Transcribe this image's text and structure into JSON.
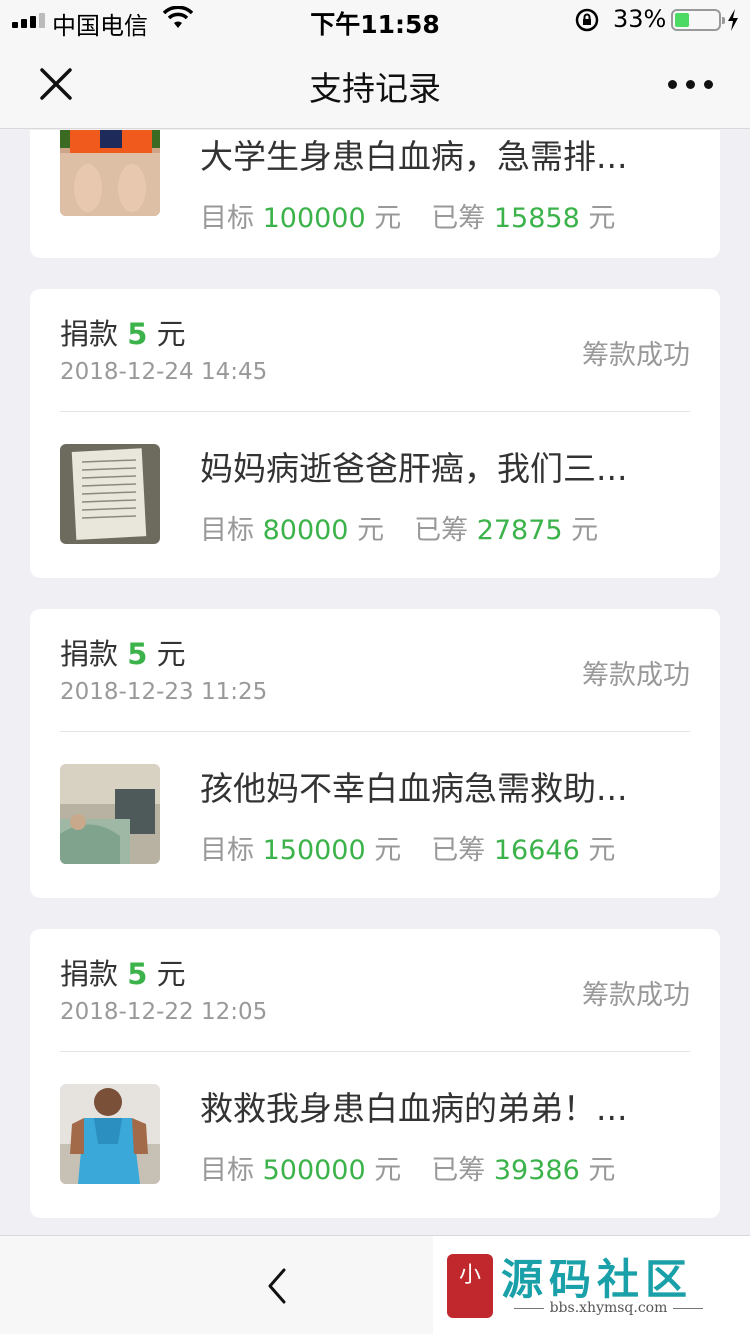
{
  "status_bar": {
    "carrier": "中国电信",
    "time": "下午11:58",
    "battery_pct": "33%",
    "battery_level": 0.33
  },
  "nav": {
    "title": "支持记录"
  },
  "labels": {
    "donate_prefix": "捐款 ",
    "donate_suffix": " 元",
    "status": "筹款成功",
    "target_label": "目标 ",
    "raised_label": "已筹 ",
    "unit": " 元"
  },
  "partial_record": {
    "project": {
      "title": "大学生身患白血病，急需排...",
      "target": "100000",
      "raised": "15858"
    }
  },
  "records": [
    {
      "amount": "5",
      "date": "2018-12-24 14:45",
      "status": "筹款成功",
      "project": {
        "title": "妈妈病逝爸爸肝癌，我们三...",
        "target": "80000",
        "raised": "27875"
      }
    },
    {
      "amount": "5",
      "date": "2018-12-23 11:25",
      "status": "筹款成功",
      "project": {
        "title": "孩他妈不幸白血病急需救助...",
        "target": "150000",
        "raised": "16646"
      }
    },
    {
      "amount": "5",
      "date": "2018-12-22 12:05",
      "status": "筹款成功",
      "project": {
        "title": "救救我身患白血病的弟弟！...",
        "target": "500000",
        "raised": "39386"
      }
    }
  ],
  "watermark": {
    "seal_text": "小猿",
    "title": "源码社区",
    "url": "bbs.xhymsq.com"
  },
  "colors": {
    "accent": "#3bb34a",
    "muted": "#999999",
    "background": "#efeff4"
  }
}
